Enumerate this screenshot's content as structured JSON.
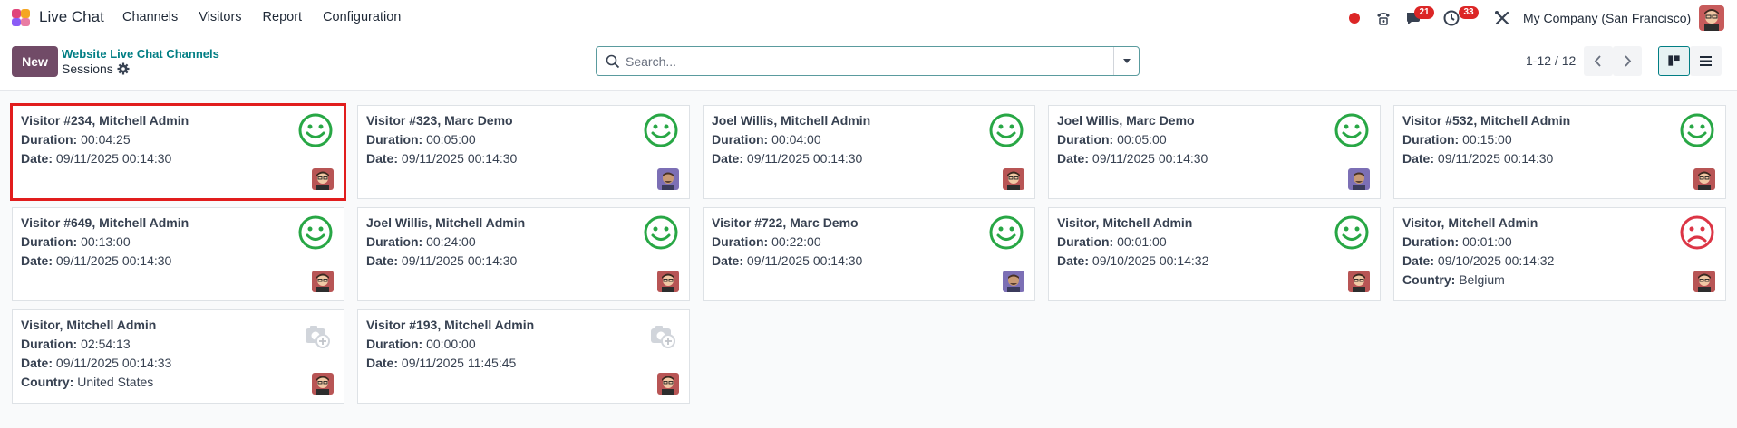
{
  "app": {
    "title": "Live Chat"
  },
  "menu": [
    "Channels",
    "Visitors",
    "Report",
    "Configuration"
  ],
  "systray": {
    "chat_count": "21",
    "activity_count": "33",
    "company": "My Company (San Francisco)"
  },
  "control": {
    "new_label": "New",
    "breadcrumb_parent": "Website Live Chat Channels",
    "breadcrumb_current": "Sessions",
    "search_placeholder": "Search...",
    "pager": "1-12 / 12"
  },
  "labels": {
    "duration": "Duration:",
    "date": "Date:",
    "country": "Country:"
  },
  "cards": [
    {
      "title": "Visitor #234, Mitchell Admin",
      "duration": "00:04:25",
      "date": "09/11/2025 00:14:30",
      "country": "",
      "mood": "happy",
      "avatar": "admin"
    },
    {
      "title": "Visitor #323, Marc Demo",
      "duration": "00:05:00",
      "date": "09/11/2025 00:14:30",
      "country": "",
      "mood": "happy",
      "avatar": "demo"
    },
    {
      "title": "Joel Willis, Mitchell Admin",
      "duration": "00:04:00",
      "date": "09/11/2025 00:14:30",
      "country": "",
      "mood": "happy",
      "avatar": "admin"
    },
    {
      "title": "Joel Willis, Marc Demo",
      "duration": "00:05:00",
      "date": "09/11/2025 00:14:30",
      "country": "",
      "mood": "happy",
      "avatar": "demo"
    },
    {
      "title": "Visitor #532, Mitchell Admin",
      "duration": "00:15:00",
      "date": "09/11/2025 00:14:30",
      "country": "",
      "mood": "happy",
      "avatar": "admin"
    },
    {
      "title": "Visitor #649, Mitchell Admin",
      "duration": "00:13:00",
      "date": "09/11/2025 00:14:30",
      "country": "",
      "mood": "happy",
      "avatar": "admin"
    },
    {
      "title": "Joel Willis, Mitchell Admin",
      "duration": "00:24:00",
      "date": "09/11/2025 00:14:30",
      "country": "",
      "mood": "happy",
      "avatar": "admin"
    },
    {
      "title": "Visitor #722, Marc Demo",
      "duration": "00:22:00",
      "date": "09/11/2025 00:14:30",
      "country": "",
      "mood": "happy",
      "avatar": "demo"
    },
    {
      "title": "Visitor, Mitchell Admin",
      "duration": "00:01:00",
      "date": "09/10/2025 00:14:32",
      "country": "",
      "mood": "happy",
      "avatar": "admin"
    },
    {
      "title": "Visitor, Mitchell Admin",
      "duration": "00:01:00",
      "date": "09/10/2025 00:14:32",
      "country": "Belgium",
      "mood": "sad",
      "avatar": "admin"
    },
    {
      "title": "Visitor, Mitchell Admin",
      "duration": "02:54:13",
      "date": "09/11/2025 00:14:33",
      "country": "United States",
      "mood": "none",
      "avatar": "admin"
    },
    {
      "title": "Visitor #193, Mitchell Admin",
      "duration": "00:00:00",
      "date": "09/11/2025 11:45:45",
      "country": "",
      "mood": "none",
      "avatar": "admin"
    }
  ],
  "colors": {
    "brand": "#714b67",
    "link": "#017e84",
    "happy": "#28a745",
    "sad": "#dc3545",
    "badge": "#dc2626"
  }
}
